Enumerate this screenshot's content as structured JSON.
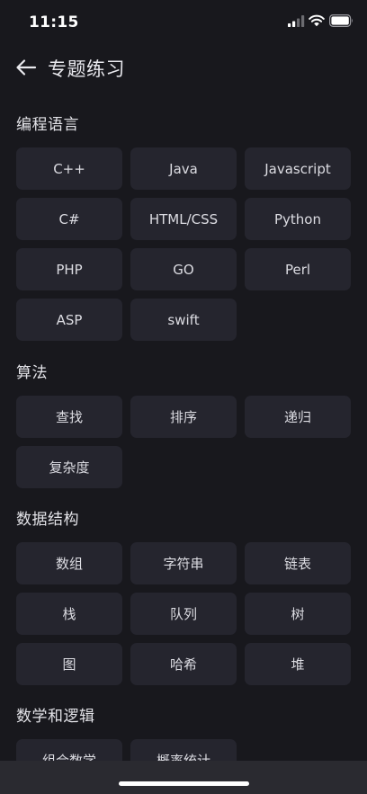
{
  "status_bar": {
    "time": "11:15"
  },
  "header": {
    "title": "专题练习"
  },
  "sections": [
    {
      "title": "编程语言",
      "items": [
        "C++",
        "Java",
        "Javascript",
        "C#",
        "HTML/CSS",
        "Python",
        "PHP",
        "GO",
        "Perl",
        "ASP",
        "swift"
      ]
    },
    {
      "title": "算法",
      "items": [
        "查找",
        "排序",
        "递归",
        "复杂度"
      ]
    },
    {
      "title": "数据结构",
      "items": [
        "数组",
        "字符串",
        "链表",
        "栈",
        "队列",
        "树",
        "图",
        "哈希",
        "堆"
      ]
    },
    {
      "title": "数学和逻辑",
      "items": [
        "组合数学",
        "概率统计"
      ]
    }
  ],
  "colors": {
    "background": "#18181d",
    "tile": "#25252e",
    "text": "#dcdce2",
    "bottom_bar": "#2a2a30"
  }
}
